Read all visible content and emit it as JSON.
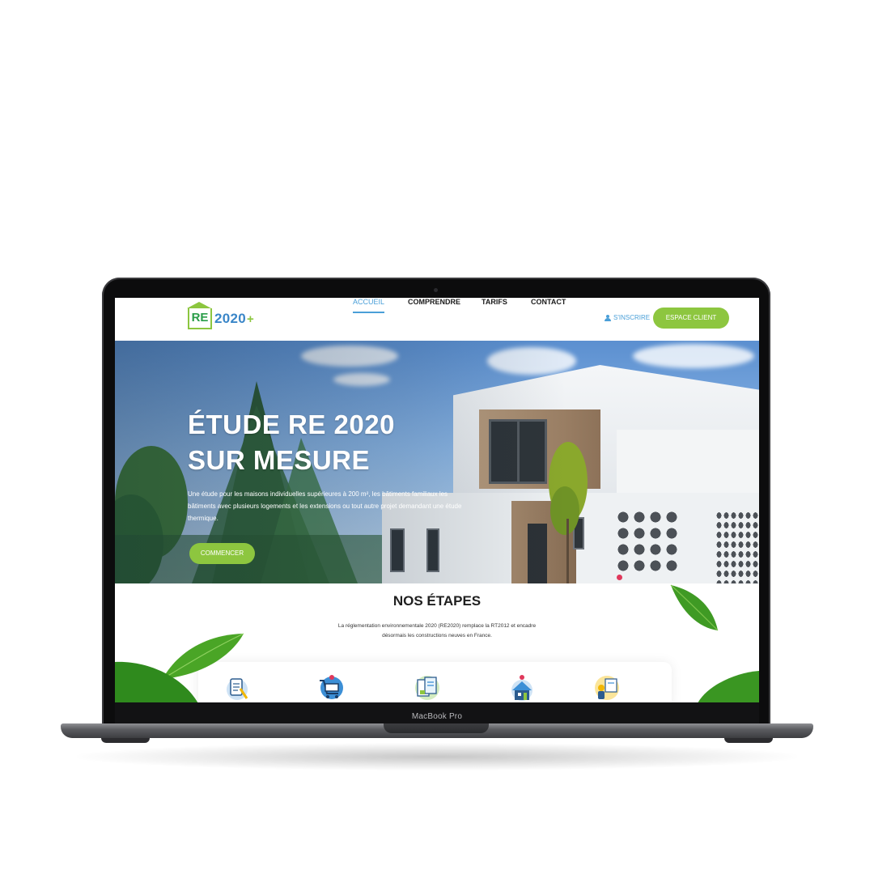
{
  "laptop": {
    "model_label": "MacBook Pro"
  },
  "nav": {
    "logo": {
      "mark": "RE",
      "text": "2020",
      "plus": "+"
    },
    "menu": [
      {
        "label": "ACCUEIL",
        "active": true
      },
      {
        "label": "COMPRENDRE",
        "active": false
      },
      {
        "label": "TARIFS",
        "active": false
      },
      {
        "label": "CONTACT",
        "active": false
      }
    ],
    "signup_label": "S'INSCRIRE",
    "client_button": "ESPACE CLIENT"
  },
  "hero": {
    "title_line1": "ÉTUDE RE 2020",
    "title_line2": "SUR MESURE",
    "description": "Une étude pour les maisons individuelles supérieures à 200 m², les bâtiments familiaux les bâtiments avec plusieurs logements et les extensions ou tout autre projet demandant une étude thermique.",
    "cta": "COMMENCER"
  },
  "steps": {
    "title": "NOS ÉTAPES",
    "description_line1": "La réglementation environnementale 2020 (RE2020) remplace la RT2012 et encadre",
    "description_line2": "désormais les constructions neuves en France.",
    "icons": [
      "document-checklist-icon",
      "shopping-cart-icon",
      "plans-documents-icon",
      "house-location-icon",
      "engineer-person-icon"
    ]
  },
  "colors": {
    "accent_green": "#8dc63f",
    "accent_blue": "#4a9fd8",
    "text_dark": "#1b1b1b"
  }
}
